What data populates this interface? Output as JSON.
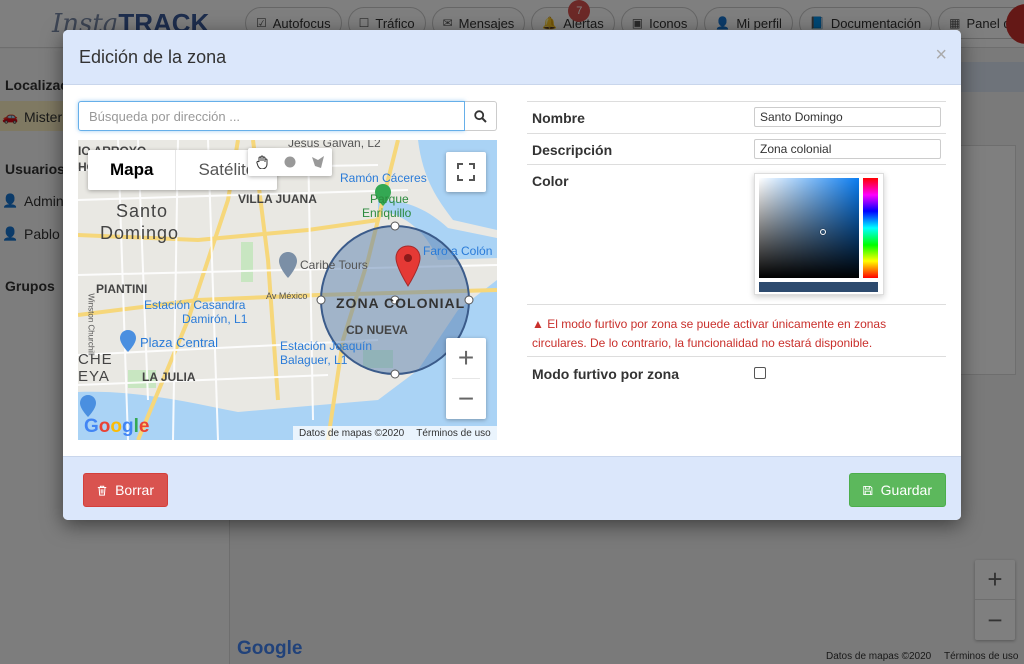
{
  "background": {
    "logo": {
      "part1": "Insta",
      "part2": "TRACK"
    },
    "nav": [
      {
        "label": "Autofocus",
        "icon": "checkbox-checked-icon"
      },
      {
        "label": "Tráfico",
        "icon": "checkbox-icon"
      },
      {
        "label": "Mensajes",
        "icon": "envelope-icon"
      },
      {
        "label": "Alertas",
        "icon": "bell-icon",
        "badge": "7"
      },
      {
        "label": "Iconos",
        "icon": "image-icon"
      },
      {
        "label": "Mi perfil",
        "icon": "user-icon"
      },
      {
        "label": "Documentación",
        "icon": "book-icon"
      },
      {
        "label": "Panel de cont",
        "icon": "table-icon"
      }
    ],
    "sidebar": {
      "localizacion": "Localizac",
      "vehicle": "Mister",
      "usuarios": "Usuarios",
      "users": [
        "Admin",
        "Pablo"
      ],
      "grupos": "Grupos"
    },
    "google": "Google",
    "attr_data": "Datos de mapas ©2020",
    "attr_terms": "Términos de uso"
  },
  "modal": {
    "title": "Edición de la zona",
    "close": "×",
    "search": {
      "placeholder": "Búsqueda por dirección ..."
    },
    "map": {
      "type_map": "Mapa",
      "type_sat": "Satélite",
      "labels": {
        "jesus_galvan": "Jesús Galván, L2",
        "io_arroyo": "IO ARROYO",
        "hondo": "HONDO",
        "ramon_caceres": "Ramón Cáceres",
        "parque": "Parque",
        "enriquillo": "Enriquillo",
        "villa_juana": "VILLA JUANA",
        "santo": "Santo",
        "domingo": "Domingo",
        "faro": "Faro a Colón",
        "caribe_tours": "Caribe Tours",
        "piantini": "PIANTINI",
        "av_mexico": "Av México",
        "estacion_casandra": "Estación Casandra",
        "damiron": "Damirón, L1",
        "zona_colonial": "ZONA COLONIAL",
        "cd_nueva": "CD NUEVA",
        "plaza_central": "Plaza Central",
        "estacion_joaquin": "Estación Joaquín",
        "balaguer": "Balaguer, L1",
        "che": "CHE",
        "eya": "EYA",
        "la_julia": "LA JULIA",
        "churchill": "Winston Churchill"
      },
      "google": "Google",
      "attr_data": "Datos de mapas ©2020",
      "attr_terms": "Términos de uso"
    },
    "form": {
      "name_label": "Nombre",
      "name_value": "Santo Domingo",
      "desc_label": "Descripción",
      "desc_value": "Zona colonial",
      "color_label": "Color",
      "color_value": "#2d4a6e",
      "warning": "El modo furtivo por zona se puede activar únicamente en zonas circulares. De lo contrario, la funcionalidad no estará disponible.",
      "stealth_label": "Modo furtivo por zona",
      "stealth_checked": false
    },
    "buttons": {
      "delete": "Borrar",
      "save": "Guardar"
    }
  },
  "colors": {
    "header_bg": "#dbe7fb",
    "delete": "#d9534f",
    "save": "#5cb85c",
    "warning": "#c9302c",
    "zone_fill": "#5a7fb0"
  }
}
